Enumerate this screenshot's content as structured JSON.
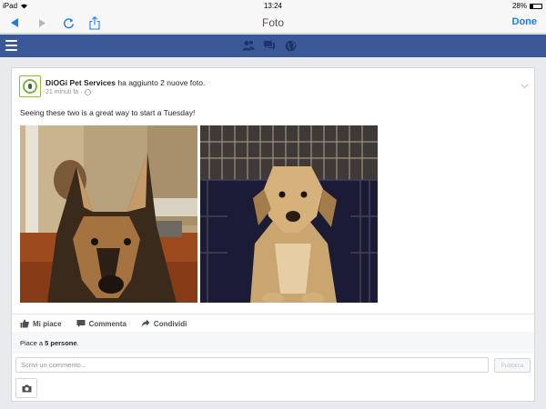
{
  "status_bar": {
    "device": "iPad",
    "time": "13:24",
    "battery": "28%",
    "battery_level": 0.28
  },
  "browser_toolbar": {
    "title": "Foto",
    "done_label": "Done",
    "icons": [
      "back-icon",
      "forward-icon",
      "reload-icon",
      "share-icon"
    ]
  },
  "facebook_bar": {
    "icons": [
      "menu-icon",
      "friends-icon",
      "messages-icon",
      "globe-icon"
    ],
    "brand_color": "#3b5998"
  },
  "post": {
    "author": "DiOGi Pet Services",
    "action": " ha aggiunto 2 nuove foto.",
    "time": "21 minuti fa",
    "time_separator": " · ",
    "text": "Seeing these two is a great way to start a Tuesday!",
    "photos": [
      "german-shepherd-photo",
      "dog-in-crate-photo"
    ],
    "actions": {
      "like": "Mi piace",
      "comment": "Commenta",
      "share": "Condividi"
    },
    "likes": {
      "prefix": "Piace a ",
      "count": "5 persone",
      "suffix": "."
    },
    "comment_box": {
      "placeholder": "Scrivi un commento...",
      "publish_label": "Pubblica"
    }
  },
  "colors": {
    "accent": "#1a7cf1",
    "facebook_blue": "#3b5998",
    "background": "#e9eaee"
  }
}
